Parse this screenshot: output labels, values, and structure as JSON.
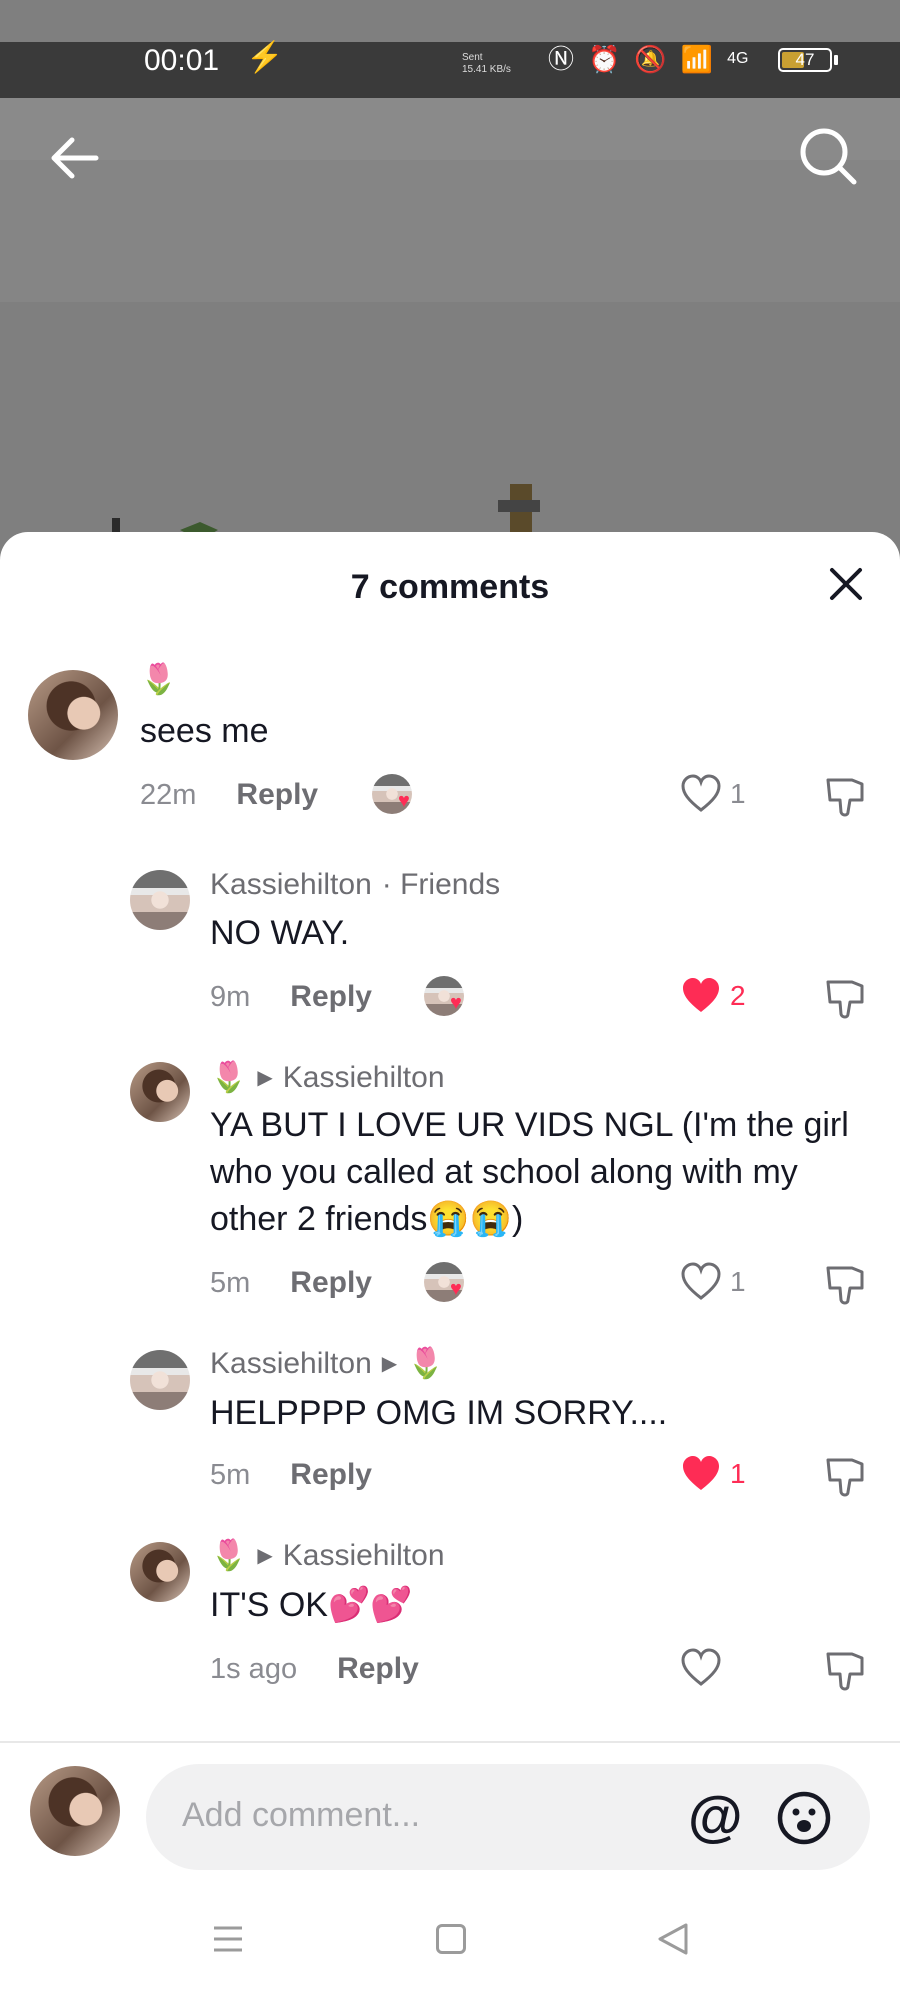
{
  "status_bar": {
    "time": "00:01",
    "speed_label": "Sent",
    "speed_value": "15.41 KB/s",
    "network": "4G",
    "battery": "47",
    "battery_level": 0.47
  },
  "top_nav": {
    "back_icon": "arrow-left-icon",
    "search_icon": "search-icon"
  },
  "sheet": {
    "title": "7 comments",
    "close_icon": "close-icon"
  },
  "comments": [
    {
      "author": "🌷",
      "text": "sees me",
      "time": "22m",
      "reply": "Reply",
      "likes": "1",
      "liked": false
    },
    {
      "author": "Kassiehilton",
      "tag": "· Friends",
      "text": "NO WAY.",
      "time": "9m",
      "reply": "Reply",
      "likes": "2",
      "liked": true
    },
    {
      "author": "🌷",
      "reply_to": "Kassiehilton",
      "text": "YA BUT I LOVE UR VIDS NGL (I'm the girl who you called at school along with my other 2 friends😭😭)",
      "time": "5m",
      "reply": "Reply",
      "likes": "1",
      "liked": false
    },
    {
      "author": "Kassiehilton",
      "reply_to": "🌷",
      "text": "HELPPPP OMG IM SORRY....",
      "time": "5m",
      "reply": "Reply",
      "likes": "1",
      "liked": true
    },
    {
      "author": "🌷",
      "reply_to": "Kassiehilton",
      "text": "IT'S OK💕💕",
      "time": "1s ago",
      "reply": "Reply",
      "likes": "",
      "liked": false
    }
  ],
  "input": {
    "placeholder": "Add comment...",
    "mention_icon": "@",
    "emoji_icon": "emoji-icon"
  },
  "colors": {
    "accent_red": "#fe2c55",
    "text_primary": "#161823",
    "text_secondary": "#8a8b91"
  }
}
